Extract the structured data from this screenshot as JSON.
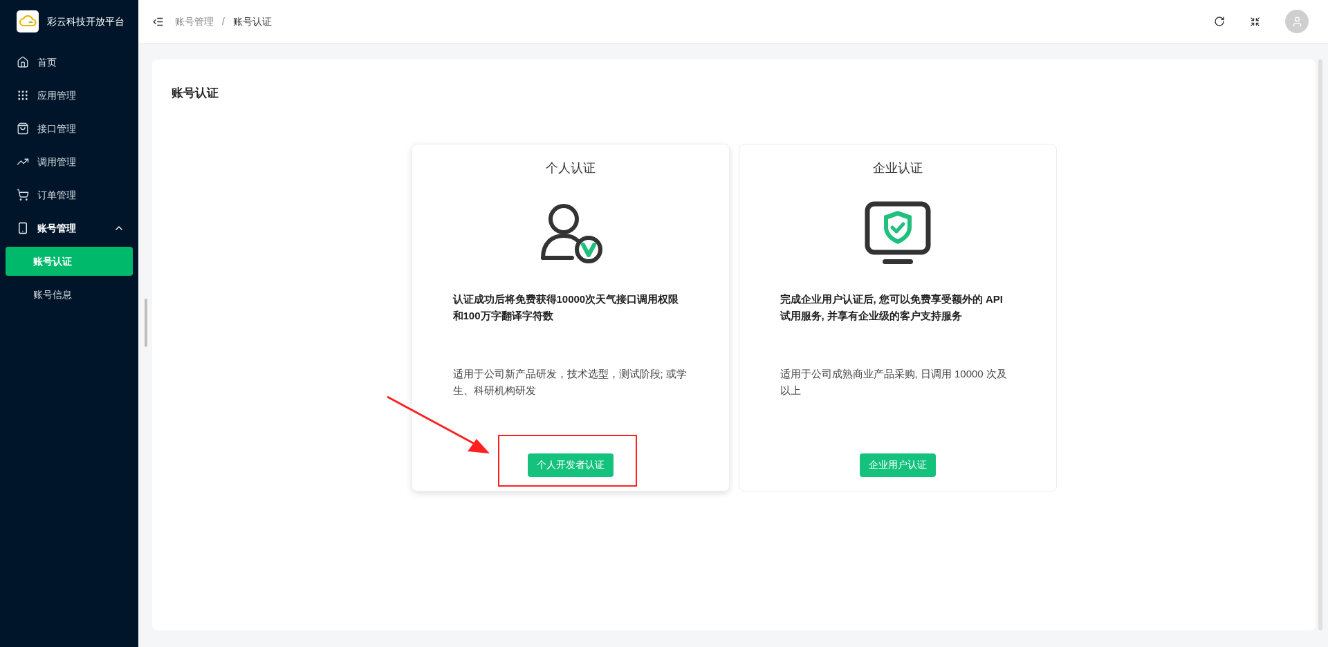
{
  "sidebar": {
    "brand": "彩云科技开放平台",
    "items": [
      {
        "label": "首页",
        "selected": false
      },
      {
        "label": "应用管理",
        "selected": false
      },
      {
        "label": "接口管理",
        "selected": false
      },
      {
        "label": "调用管理",
        "selected": false
      },
      {
        "label": "订单管理",
        "selected": false
      },
      {
        "label": "账号管理",
        "selected": false,
        "expanded": true,
        "children": [
          {
            "label": "账号认证",
            "selected": true
          },
          {
            "label": "账号信息",
            "selected": false
          }
        ]
      }
    ]
  },
  "breadcrumb": [
    "账号管理",
    "账号认证"
  ],
  "breadcrumb_separator": "/",
  "page": {
    "title": "账号认证",
    "cards": [
      {
        "title": "个人认证",
        "description": "认证成功后将免费获得10000次天气接口调用权限和100万字翻译字符数",
        "note": "适用于公司新产品研发，技术选型，测试阶段; 或学生、科研机构研发",
        "button": "个人开发者认证",
        "highlighted": true
      },
      {
        "title": "企业认证",
        "description": "完成企业用户认证后, 您可以免费享受额外的 API 试用服务, 并享有企业级的客户支持服务",
        "note": "适用于公司成熟商业产品采购, 日调用 10000 次及以上",
        "button": "企业用户认证",
        "highlighted": false
      }
    ]
  }
}
